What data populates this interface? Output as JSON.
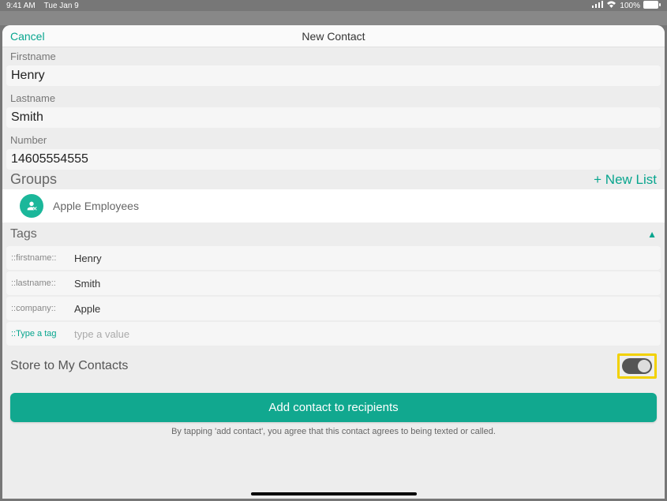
{
  "status": {
    "time": "9:41 AM",
    "date": "Tue Jan 9",
    "battery": "100%"
  },
  "nav": {
    "cancel": "Cancel",
    "title": "New Contact"
  },
  "fields": {
    "firstname_label": "Firstname",
    "firstname_value": "Henry",
    "lastname_label": "Lastname",
    "lastname_value": "Smith",
    "number_label": "Number",
    "number_value": "14605554555"
  },
  "groups": {
    "label": "Groups",
    "new_list": "+ New List",
    "items": [
      {
        "name": "Apple Employees"
      }
    ]
  },
  "tags": {
    "label": "Tags",
    "rows": [
      {
        "key": "::firstname::",
        "value": "Henry"
      },
      {
        "key": "::lastname::",
        "value": "Smith"
      },
      {
        "key": "::company::",
        "value": "Apple"
      }
    ],
    "new_key_placeholder": "::Type a tag",
    "new_value_placeholder": "type a value"
  },
  "store": {
    "label": "Store to My Contacts",
    "on": false
  },
  "actions": {
    "add_button": "Add contact to recipients",
    "disclaimer": "By tapping 'add contact', you agree that this contact agrees to being texted or called."
  }
}
